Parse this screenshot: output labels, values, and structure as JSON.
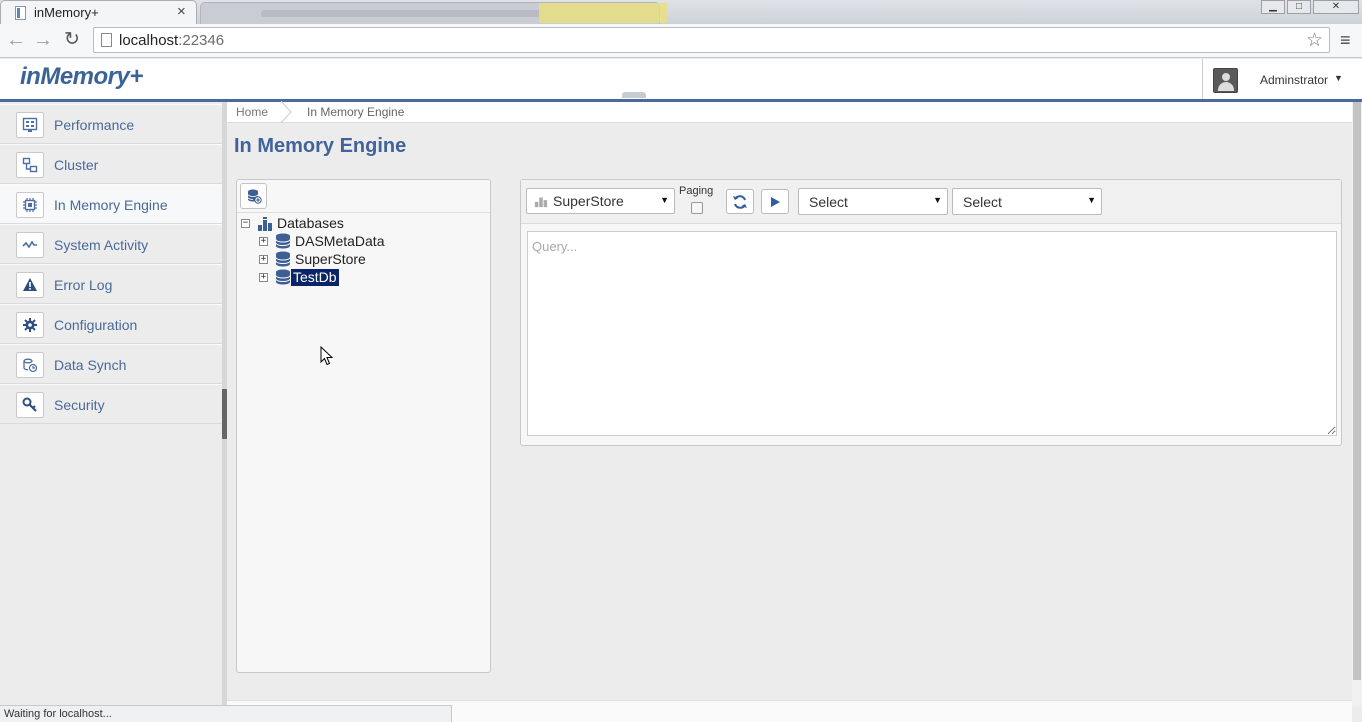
{
  "browser": {
    "tab_title": "inMemory+",
    "tab_close": "×",
    "url_host": "localhost",
    "url_port": ":22346",
    "back_icon": "←",
    "forward_icon": "→",
    "reload_icon": "↻",
    "star_icon": "☆",
    "menu_icon": "≡",
    "window_min": "▁",
    "window_max": "□",
    "window_close": "✕"
  },
  "header": {
    "brand": "inMemory+",
    "user_name": "Adminstrator",
    "user_caret": "▼"
  },
  "sidebar": {
    "items": [
      {
        "label": "Performance",
        "icon": "performance-icon"
      },
      {
        "label": "Cluster",
        "icon": "cluster-icon"
      },
      {
        "label": "In Memory Engine",
        "icon": "engine-icon",
        "active": true
      },
      {
        "label": "System Activity",
        "icon": "activity-icon"
      },
      {
        "label": "Error Log",
        "icon": "warning-icon"
      },
      {
        "label": "Configuration",
        "icon": "gear-icon"
      },
      {
        "label": "Data Synch",
        "icon": "sync-icon"
      },
      {
        "label": "Security",
        "icon": "key-icon"
      }
    ]
  },
  "breadcrumb": {
    "home": "Home",
    "current": "In Memory Engine"
  },
  "page": {
    "title": "In Memory Engine"
  },
  "tree": {
    "root": "Databases",
    "databases": [
      {
        "name": "DASMetaData",
        "selected": false
      },
      {
        "name": "SuperStore",
        "selected": false
      },
      {
        "name": "TestDb",
        "selected": true
      }
    ]
  },
  "query": {
    "database": "SuperStore",
    "paging_label": "Paging",
    "select1": "Select",
    "select2": "Select",
    "placeholder": "Query...",
    "caret": "▼"
  },
  "status": {
    "text": "Waiting for localhost..."
  },
  "colors": {
    "accent": "#41639a",
    "selection": "#0a246a",
    "header_border": "#4a6a9e"
  }
}
